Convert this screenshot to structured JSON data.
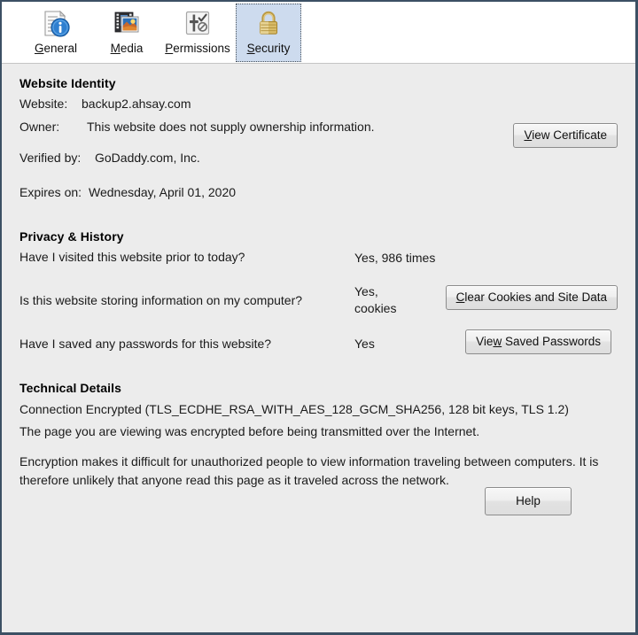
{
  "tabs": [
    {
      "label_pre": "",
      "label_key": "G",
      "label_post": "eneral",
      "full": "General",
      "icon": "page-info-icon",
      "selected": false
    },
    {
      "label_pre": "",
      "label_key": "M",
      "label_post": "edia",
      "full": "Media",
      "icon": "media-film-icon",
      "selected": false
    },
    {
      "label_pre": "",
      "label_key": "P",
      "label_post": "ermissions",
      "full": "Permissions",
      "icon": "permissions-slider-icon",
      "selected": false
    },
    {
      "label_pre": "",
      "label_key": "S",
      "label_post": "ecurity",
      "full": "Security",
      "icon": "padlock-icon",
      "selected": true
    }
  ],
  "website_identity": {
    "title": "Website Identity",
    "website_label": "Website:",
    "website_value": "backup2.ahsay.com",
    "owner_label": "Owner:",
    "owner_value": "This website does not supply ownership information.",
    "verified_label": "Verified by:",
    "verified_value": "GoDaddy.com, Inc.",
    "expires_label": "Expires on:",
    "expires_value": "Wednesday, April 01, 2020",
    "view_certificate_pre": "",
    "view_certificate_key": "V",
    "view_certificate_post": "iew Certificate",
    "view_certificate_full": "View Certificate"
  },
  "privacy_history": {
    "title": "Privacy & History",
    "visited_question": "Have I visited this website prior to today?",
    "visited_answer": "Yes, 986 times",
    "storing_question": "Is this website storing information on my computer?",
    "storing_answer_line1": "Yes,",
    "storing_answer_line2": "cookies",
    "passwords_question": "Have I saved any passwords for this website?",
    "passwords_answer": "Yes",
    "clear_cookies_pre": "",
    "clear_cookies_key": "C",
    "clear_cookies_post": "lear Cookies and Site Data",
    "clear_cookies_full": "Clear Cookies and Site Data",
    "view_passwords_pre": "Vie",
    "view_passwords_key": "w",
    "view_passwords_post": " Saved Passwords",
    "view_passwords_full": "View Saved Passwords"
  },
  "technical_details": {
    "title": "Technical Details",
    "connection_line": "Connection Encrypted (TLS_ECDHE_RSA_WITH_AES_128_GCM_SHA256, 128 bit keys, TLS 1.2)",
    "encrypted_line": "The page you are viewing was encrypted before being transmitted over the Internet.",
    "explanation": "Encryption makes it difficult for unauthorized people to view information traveling between computers. It is therefore unlikely that anyone read this page as it traveled across the network."
  },
  "help_button": {
    "label": "Help"
  },
  "colors": {
    "window_border": "#3c5064",
    "toolbar_bg": "#ffffff",
    "content_bg": "#ececec",
    "selected_tab_bg": "#cddbee",
    "text": "#1a1a1a",
    "padlock_gold": "#d4b05a",
    "info_blue": "#1c6fc4"
  }
}
